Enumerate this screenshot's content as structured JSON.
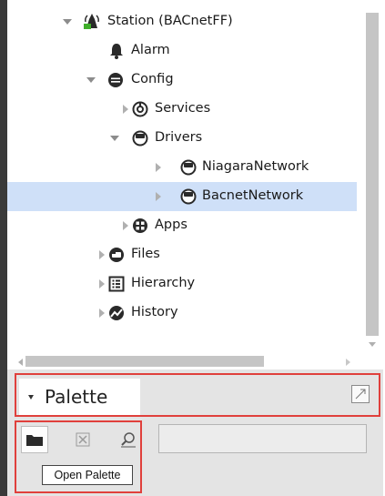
{
  "nav_tree": {
    "nodes": [
      {
        "label": "Station (BACnetFF)",
        "icon": "station-icon",
        "expanded": true,
        "selected": false
      },
      {
        "label": "Alarm",
        "icon": "bell-icon",
        "expanded": null,
        "selected": false
      },
      {
        "label": "Config",
        "icon": "database-icon",
        "expanded": true,
        "selected": false
      },
      {
        "label": "Services",
        "icon": "services-icon",
        "expanded": false,
        "selected": false
      },
      {
        "label": "Drivers",
        "icon": "drivers-icon",
        "expanded": true,
        "selected": false
      },
      {
        "label": "NiagaraNetwork",
        "icon": "network-icon",
        "expanded": false,
        "selected": false
      },
      {
        "label": "BacnetNetwork",
        "icon": "network-icon",
        "expanded": false,
        "selected": true
      },
      {
        "label": "Apps",
        "icon": "apps-icon",
        "expanded": false,
        "selected": false
      },
      {
        "label": "Files",
        "icon": "files-icon",
        "expanded": false,
        "selected": false
      },
      {
        "label": "Hierarchy",
        "icon": "hierarchy-icon",
        "expanded": false,
        "selected": false
      },
      {
        "label": "History",
        "icon": "history-icon",
        "expanded": false,
        "selected": false
      }
    ]
  },
  "palette": {
    "title": "Palette",
    "toolbar": {
      "open_icon": "folder-icon",
      "close_icon": "close-icon",
      "find_icon": "find-icon"
    },
    "tooltip": "Open Palette",
    "search_value": ""
  },
  "colors": {
    "selection": "#cfe0f8",
    "highlight_border": "#e0403c",
    "panel_bg": "#e4e4e4",
    "left_edge": "#3a3a3a"
  }
}
